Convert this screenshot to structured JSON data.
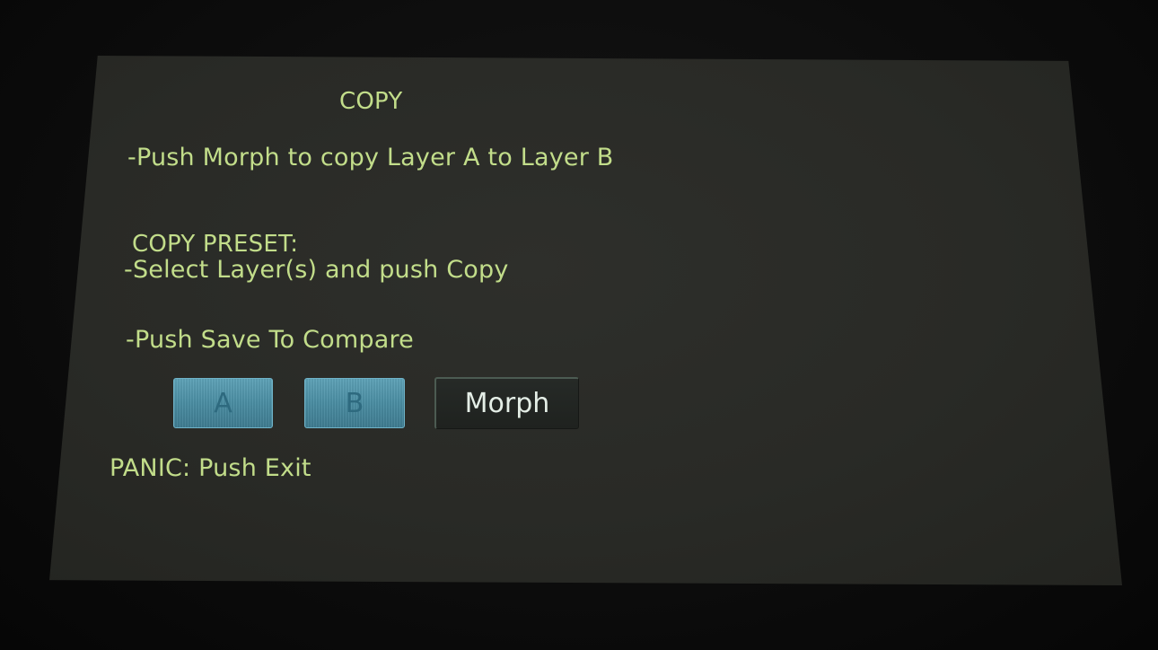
{
  "screen": {
    "title": "COPY",
    "instruction_morph": "-Push Morph to copy Layer A to Layer B",
    "copy_preset_label": "COPY PRESET:",
    "copy_preset_instruction": "-Select Layer(s) and push Copy",
    "compare_instruction": "-Push Save To Compare",
    "panic_text": "PANIC: Push Exit"
  },
  "buttons": {
    "layer_a": "A",
    "layer_b": "B",
    "morph": "Morph"
  },
  "colors": {
    "text": "#c2dd8a",
    "layer_button": "#4b8ea3",
    "morph_button": "#222522",
    "screen_bg": "#2b2c28"
  }
}
